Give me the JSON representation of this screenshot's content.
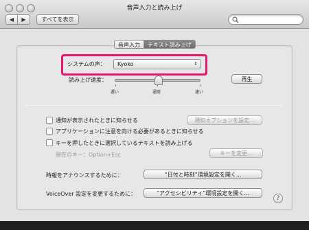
{
  "window": {
    "title": "音声入力と読み上げ"
  },
  "toolbar": {
    "back_label": "◀",
    "forward_label": "▶",
    "show_all_label": "すべてを表示"
  },
  "tabs": [
    {
      "label": "音声入力"
    },
    {
      "label": "テキスト読み上げ"
    }
  ],
  "voice": {
    "label": "システムの声：",
    "selected": "Kyoko",
    "arrows": "⇕"
  },
  "rate": {
    "label": "読み上げ速度：",
    "slow": "遅い",
    "normal": "通常",
    "fast": "速い",
    "play_button": "再生",
    "value_fraction": 0.5
  },
  "notifications": {
    "alerts_label": "通知が表示されたときに知らせる",
    "alerts_button": "通知オプションを設定...",
    "attention_label": "アプリケーションに注意を向ける必要があるときに知らせる",
    "hotkey_label": "キーを押したときに選択しているテキストを読み上げる",
    "current_key_label": "現在のキー：Option+Esc",
    "change_key_button": "キーを変更..."
  },
  "announce": {
    "label": "時報をアナウンスするために：",
    "button": "“日付と時刻”環境設定を開く..."
  },
  "voiceover": {
    "label": "VoiceOver 設定を変更するために：",
    "button": "“アクセシビリティ”環境設定を開く..."
  },
  "help": {
    "label": "?"
  },
  "colors": {
    "highlight": "#e8156e",
    "tab_active": "#7a7a7a"
  }
}
